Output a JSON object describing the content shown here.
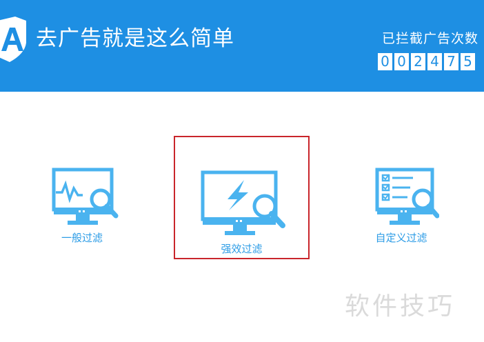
{
  "header": {
    "title": "去广告就是这么简单",
    "counter_label": "已拦截广告次数",
    "counter_digits": [
      "0",
      "0",
      "2",
      "4",
      "7",
      "5"
    ]
  },
  "modes": [
    {
      "label": "一般过滤",
      "icon": "monitor-pulse-search-icon"
    },
    {
      "label": "强效过滤",
      "icon": "monitor-lightning-search-icon",
      "selected": true
    },
    {
      "label": "自定义过滤",
      "icon": "monitor-checklist-search-icon"
    }
  ],
  "watermark": "软件技巧",
  "colors": {
    "header_bg": "#1e8fe3",
    "icon_blue": "#4ab3ef",
    "selection_border": "#c9252b"
  }
}
